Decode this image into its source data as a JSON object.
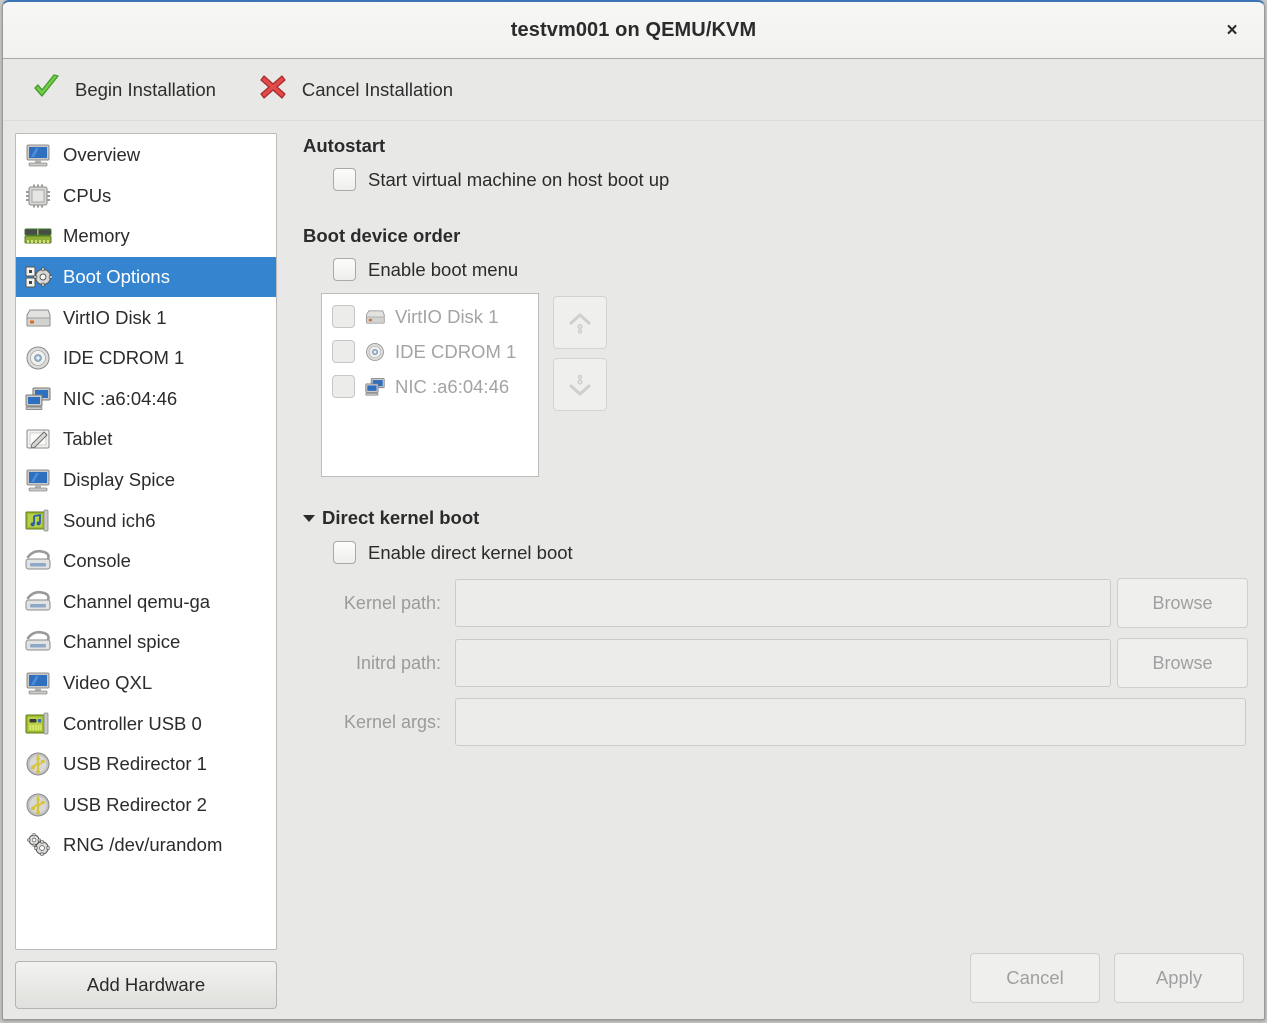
{
  "window": {
    "title": "testvm001 on QEMU/KVM",
    "close_label": "×",
    "accent_color": "#3584d0",
    "titlebar_color": "#f5f5f4",
    "body_color": "#e8e8e6"
  },
  "toolbar": {
    "begin_label": "Begin Installation",
    "cancel_label": "Cancel Installation"
  },
  "sidebar": {
    "items": [
      {
        "label": "Overview",
        "icon": "monitor-icon",
        "selected": false
      },
      {
        "label": "CPUs",
        "icon": "cpu-chip-icon",
        "selected": false
      },
      {
        "label": "Memory",
        "icon": "memory-ram-icon",
        "selected": false
      },
      {
        "label": "Boot Options",
        "icon": "boot-gear-icon",
        "selected": true
      },
      {
        "label": "VirtIO Disk 1",
        "icon": "hard-disk-icon",
        "selected": false
      },
      {
        "label": "IDE CDROM 1",
        "icon": "cdrom-disc-icon",
        "selected": false
      },
      {
        "label": "NIC :a6:04:46",
        "icon": "network-card-icon",
        "selected": false
      },
      {
        "label": "Tablet",
        "icon": "tablet-pen-icon",
        "selected": false
      },
      {
        "label": "Display Spice",
        "icon": "monitor-icon",
        "selected": false
      },
      {
        "label": "Sound ich6",
        "icon": "sound-card-icon",
        "selected": false
      },
      {
        "label": "Console",
        "icon": "console-plug-icon",
        "selected": false
      },
      {
        "label": "Channel qemu-ga",
        "icon": "console-plug-icon",
        "selected": false
      },
      {
        "label": "Channel spice",
        "icon": "console-plug-icon",
        "selected": false
      },
      {
        "label": "Video QXL",
        "icon": "monitor-icon",
        "selected": false
      },
      {
        "label": "Controller USB 0",
        "icon": "controller-card-icon",
        "selected": false
      },
      {
        "label": "USB Redirector 1",
        "icon": "usb-icon",
        "selected": false
      },
      {
        "label": "USB Redirector 2",
        "icon": "usb-icon",
        "selected": false
      },
      {
        "label": "RNG /dev/urandom",
        "icon": "rng-gears-icon",
        "selected": false
      }
    ],
    "add_hardware_label": "Add Hardware"
  },
  "main": {
    "autostart": {
      "title": "Autostart",
      "checkbox_label": "Start virtual machine on host boot up",
      "checked": false
    },
    "boot_order": {
      "title": "Boot device order",
      "enable_menu_label": "Enable boot menu",
      "enable_menu_checked": false,
      "devices": [
        {
          "label": "VirtIO Disk 1",
          "icon": "hard-disk-icon",
          "checked": false
        },
        {
          "label": "IDE CDROM 1",
          "icon": "cdrom-disc-icon",
          "checked": false
        },
        {
          "label": "NIC :a6:04:46",
          "icon": "network-card-icon",
          "checked": false
        }
      ],
      "move_up_icon": "double-chevron-up-icon",
      "move_down_icon": "double-chevron-down-icon"
    },
    "direct_kernel_boot": {
      "title": "Direct kernel boot",
      "expanded": true,
      "enable_label": "Enable direct kernel boot",
      "enable_checked": false,
      "fields": [
        {
          "label": "Kernel path:",
          "value": "",
          "browse_label": "Browse",
          "has_browse": true
        },
        {
          "label": "Initrd path:",
          "value": "",
          "browse_label": "Browse",
          "has_browse": true
        },
        {
          "label": "Kernel args:",
          "value": "",
          "browse_label": "",
          "has_browse": false
        }
      ]
    }
  },
  "footer": {
    "cancel_label": "Cancel",
    "apply_label": "Apply"
  }
}
